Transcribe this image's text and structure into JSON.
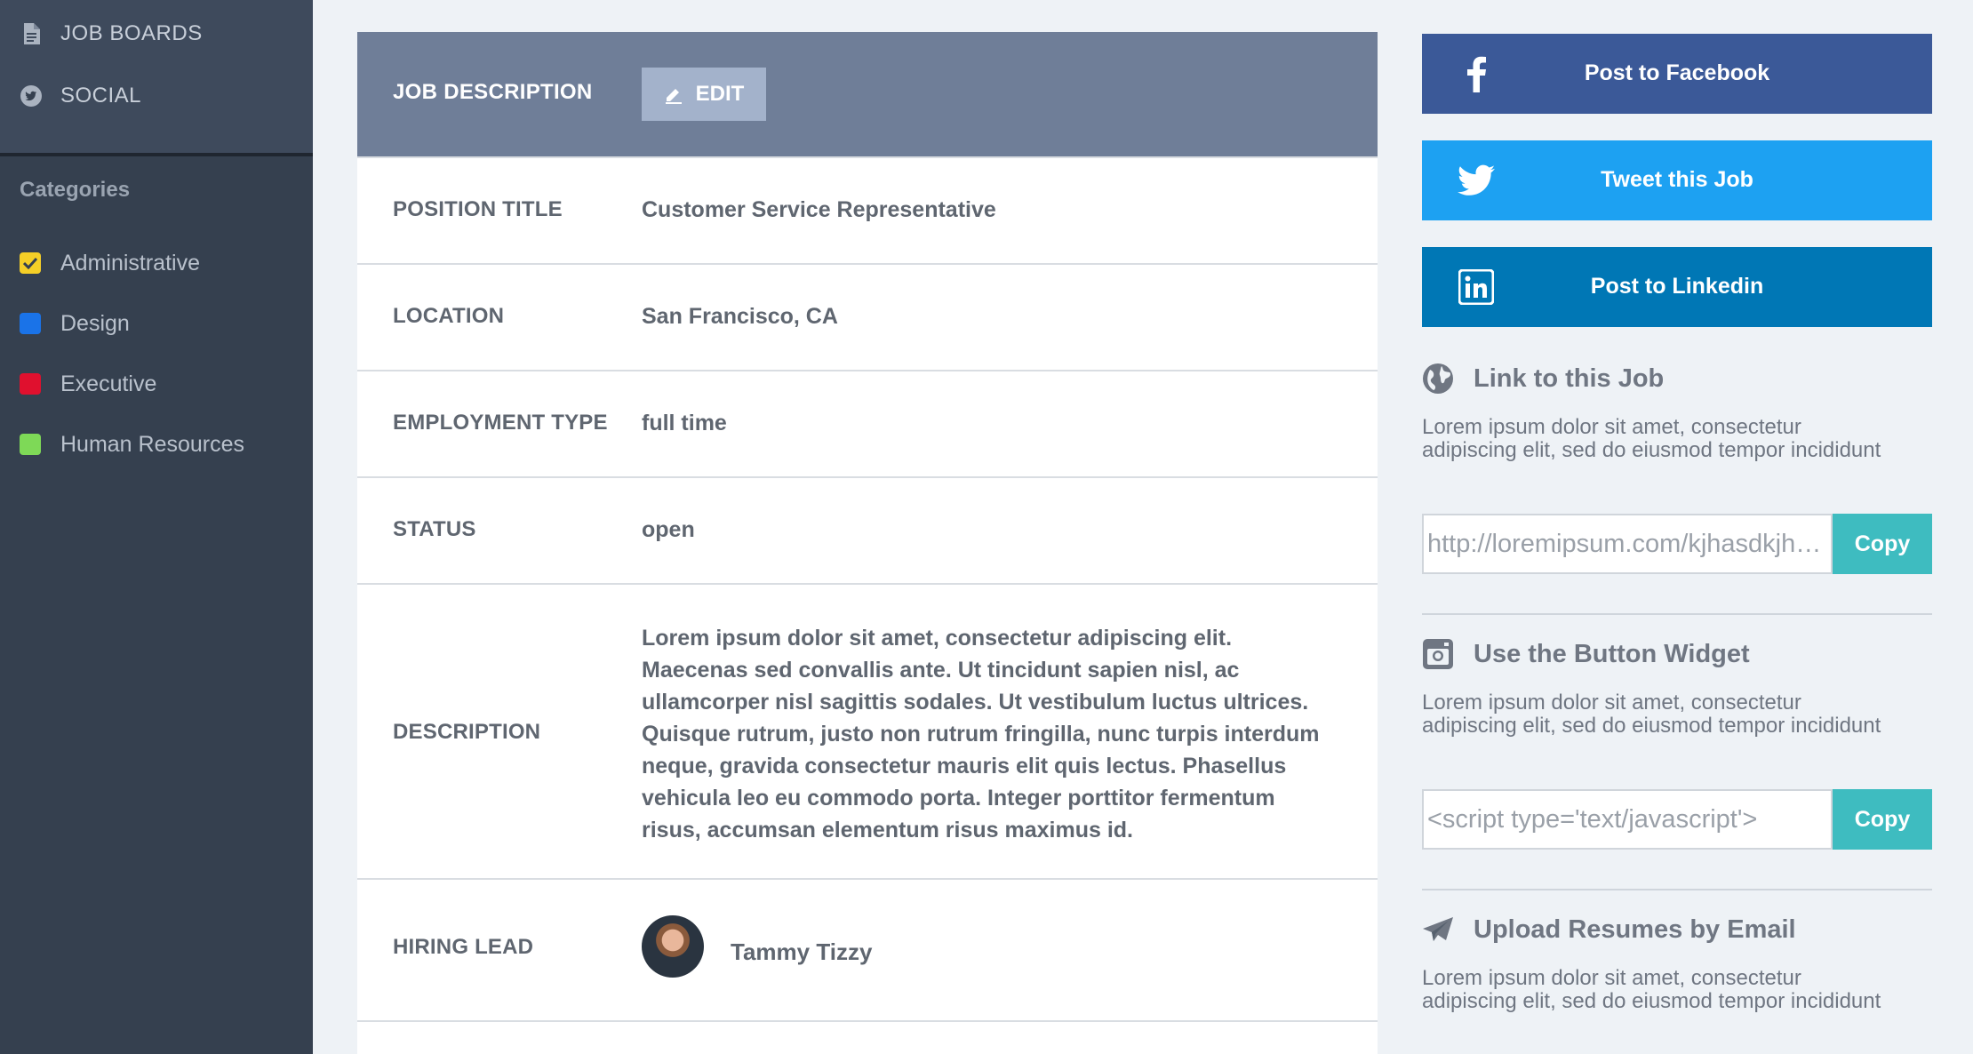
{
  "sidebar": {
    "nav": [
      {
        "label": "JOB BOARDS",
        "icon": "document-icon"
      },
      {
        "label": "SOCIAL",
        "icon": "twitter-icon"
      }
    ],
    "categories_heading": "Categories",
    "categories": [
      {
        "label": "Administrative",
        "color": "#f5cf27",
        "checked": true
      },
      {
        "label": "Design",
        "color": "#1a73e8",
        "checked": false
      },
      {
        "label": "Executive",
        "color": "#e0102e",
        "checked": false
      },
      {
        "label": "Human Resources",
        "color": "#7ed957",
        "checked": false
      }
    ]
  },
  "job": {
    "header_title": "JOB DESCRIPTION",
    "edit_label": "EDIT",
    "fields": [
      {
        "label": "POSITION TITLE",
        "value": "Customer Service Representative"
      },
      {
        "label": "LOCATION",
        "value": "San Francisco, CA"
      },
      {
        "label": "EMPLOYMENT TYPE",
        "value": "full time"
      },
      {
        "label": "STATUS",
        "value": "open"
      }
    ],
    "description_label": "DESCRIPTION",
    "description": "Lorem ipsum dolor sit amet, consectetur adipiscing elit. Maecenas sed convallis ante. Ut tincidunt sapien nisl, ac ullamcorper nisl sagittis sodales. Ut vestibulum luctus ultrices. Quisque rutrum, justo non rutrum fringilla, nunc turpis interdum neque, gravida consectetur mauris elit quis lectus. Phasellus vehicula leo eu commodo porta. Integer porttitor fermentum risus, accumsan elementum risus maximus id.",
    "hiring_lead_label": "HIRING LEAD",
    "hiring_lead": "Tammy Tizzy"
  },
  "share": {
    "facebook_label": "Post to Facebook",
    "twitter_label": "Tweet this Job",
    "linkedin_label": "Post to Linkedin",
    "colors": {
      "facebook": "#3b5998",
      "twitter": "#1da1f2",
      "linkedin": "#0077b5",
      "copy": "#3ebcc0"
    }
  },
  "link_section": {
    "title": "Link to this Job",
    "desc": "Lorem ipsum dolor sit amet, consectetur adipiscing elit, sed do eiusmod tempor incididunt",
    "input_value": "http://loremipsum.com/kjhasdkjhasd",
    "copy_label": "Copy"
  },
  "widget_section": {
    "title": "Use the Button Widget",
    "desc": "Lorem ipsum dolor sit amet, consectetur adipiscing elit, sed do eiusmod tempor incididunt",
    "input_value": "<script type='text/javascript'>",
    "copy_label": "Copy"
  },
  "upload_section": {
    "title": "Upload Resumes by Email",
    "desc": "Lorem ipsum dolor sit amet, consectetur adipiscing elit, sed do eiusmod tempor incididunt"
  }
}
